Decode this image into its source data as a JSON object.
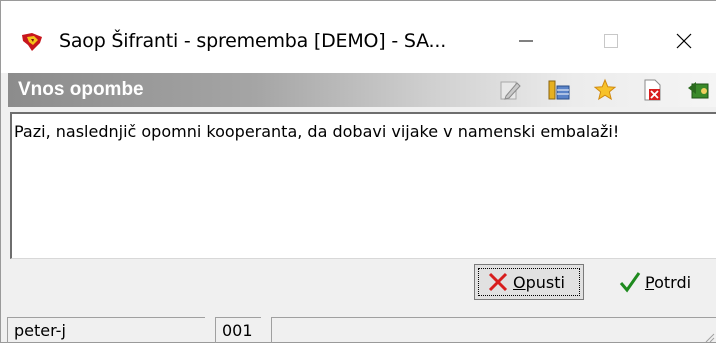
{
  "window": {
    "title": "Saop  Šifranti  - sprememba [DEMO] - SA...",
    "app_icon": "saop-app-icon"
  },
  "section": {
    "title": "Vnos opombe",
    "toolbar_icons": [
      "edit-pencil-icon",
      "columns-icon",
      "favorite-star-icon",
      "delete-document-icon",
      "exit-icon"
    ]
  },
  "note": {
    "text": "Pazi, naslednjič opomni kooperanta, da dobavi vijake v namenski embalaži!"
  },
  "buttons": {
    "cancel_mnemonic": "O",
    "cancel_rest": "pusti",
    "confirm_mnemonic": "P",
    "confirm_rest": "otrdi"
  },
  "statusbar": {
    "user": "peter-j",
    "code": "001",
    "extra": ""
  },
  "colors": {
    "header_dark": "#8c8c8c",
    "cancel_red": "#d81e1e",
    "confirm_green": "#1e8a1e"
  }
}
